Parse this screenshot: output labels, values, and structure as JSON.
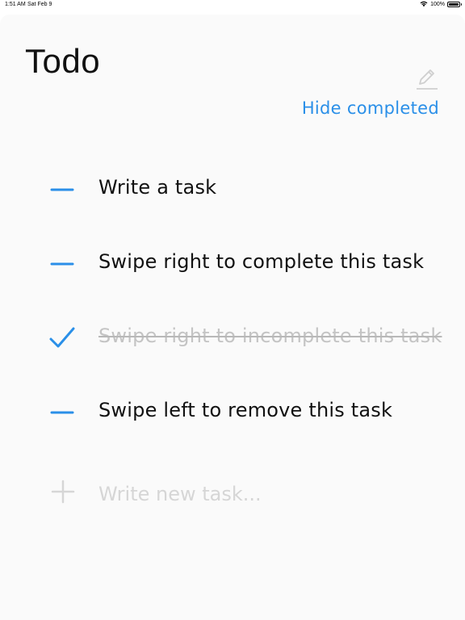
{
  "status_bar": {
    "time": "1:51 AM",
    "date": "Sat Feb 9",
    "battery": "100%"
  },
  "header": {
    "title": "Todo",
    "edit_icon": "pencil-icon",
    "hide_completed_label": "Hide completed"
  },
  "tasks": [
    {
      "text": "Write a task",
      "completed": false,
      "marker_icon": "dash-icon"
    },
    {
      "text": "Swipe right to complete this task",
      "completed": false,
      "marker_icon": "dash-icon"
    },
    {
      "text": "Swipe right to incomplete this task",
      "completed": true,
      "marker_icon": "checkmark-icon"
    },
    {
      "text": "Swipe left to remove this task",
      "completed": false,
      "marker_icon": "dash-icon"
    }
  ],
  "new_task": {
    "placeholder": "Write new task...",
    "value": "",
    "add_icon": "plus-icon"
  },
  "colors": {
    "accent": "#2a8fe8",
    "completed_text": "#c4c4c4",
    "placeholder": "#d6d6d6",
    "background": "#fafafa"
  }
}
